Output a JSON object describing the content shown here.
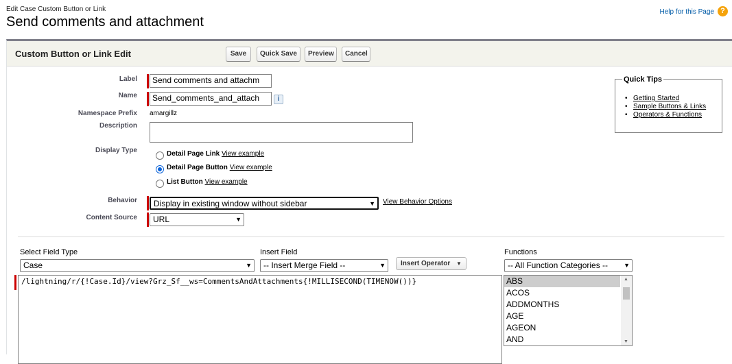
{
  "header": {
    "breadcrumb": "Edit Case Custom Button or Link",
    "title": "Send comments and attachment",
    "help_link": "Help for this Page",
    "help_icon": "?"
  },
  "card": {
    "title": "Custom Button or Link Edit",
    "buttons": {
      "save": "Save",
      "quick_save": "Quick Save",
      "preview": "Preview",
      "cancel": "Cancel"
    }
  },
  "form": {
    "label": {
      "label": "Label",
      "value": "Send comments and attachm"
    },
    "name": {
      "label": "Name",
      "value": "Send_comments_and_attach",
      "info": "i"
    },
    "namespace": {
      "label": "Namespace Prefix",
      "value": "amargillz"
    },
    "description": {
      "label": "Description",
      "value": ""
    },
    "display_type": {
      "label": "Display Type",
      "options": [
        {
          "label": "Detail Page Link",
          "link": "View example",
          "checked": false
        },
        {
          "label": "Detail Page Button",
          "link": "View example",
          "checked": true
        },
        {
          "label": "List Button",
          "link": "View example",
          "checked": false
        }
      ]
    },
    "behavior": {
      "label": "Behavior",
      "value": "Display in existing window without sidebar",
      "link": "View Behavior Options"
    },
    "content_source": {
      "label": "Content Source",
      "value": "URL"
    }
  },
  "quick_tips": {
    "title": "Quick Tips",
    "items": [
      "Getting Started",
      "Sample Buttons & Links",
      "Operators & Functions"
    ]
  },
  "editor": {
    "select_field_type": {
      "label": "Select Field Type",
      "value": "Case"
    },
    "insert_field": {
      "label": "Insert Field",
      "value": "-- Insert Merge Field --"
    },
    "insert_operator": "Insert Operator",
    "functions": {
      "label": "Functions",
      "category": "-- All Function Categories --",
      "items": [
        "ABS",
        "ACOS",
        "ADDMONTHS",
        "AGE",
        "AGEON",
        "AND"
      ]
    },
    "formula": "/lightning/r/{!Case.Id}/view?Grz_Sf__ws=CommentsAndAttachments{!MILLISECOND(TIMENOW())}"
  }
}
